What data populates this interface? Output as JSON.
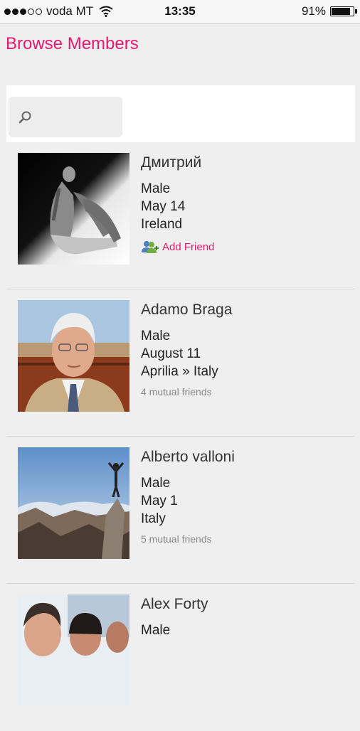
{
  "status": {
    "carrier": "voda MT",
    "time": "13:35",
    "battery": "91%",
    "battery_level": 0.91,
    "signal_bars": 3,
    "signal_total": 5
  },
  "page": {
    "title": "Browse Members"
  },
  "search": {
    "placeholder": ""
  },
  "members": [
    {
      "name": "Дмитрий",
      "gender": "Male",
      "birthday": "May 14",
      "location": "Ireland",
      "action": "Add Friend"
    },
    {
      "name": "Adamo Braga",
      "gender": "Male",
      "birthday": "August 11",
      "location": "Aprilia » Italy",
      "mutual": "4 mutual friends"
    },
    {
      "name": "Alberto valloni",
      "gender": "Male",
      "birthday": "May 1",
      "location": "Italy",
      "mutual": "5 mutual friends"
    },
    {
      "name": "Alex Forty",
      "gender": "Male"
    }
  ],
  "colors": {
    "accent": "#e6196e",
    "background": "#efefef"
  }
}
